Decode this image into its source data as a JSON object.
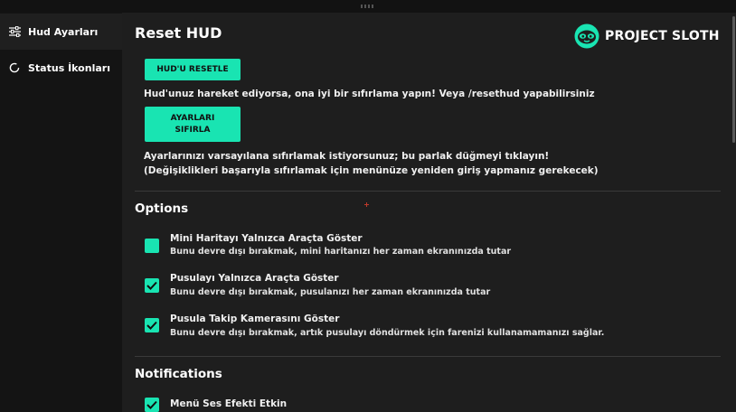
{
  "sidebar": {
    "items": [
      {
        "label": "Hud Ayarları",
        "icon": "sliders-icon",
        "active": true
      },
      {
        "label": "Status İkonları",
        "icon": "circle-loader-icon",
        "active": false
      }
    ]
  },
  "header": {
    "title": "Reset HUD",
    "logo_text": "PROJECT SLOTH"
  },
  "reset": {
    "hud_button": "HUD'U RESETLE",
    "hud_text": "Hud'unuz hareket ediyorsa, ona iyi bir sıfırlama yapın! Veya /resethud yapabilirsiniz",
    "settings_button_line1": "AYARLARI",
    "settings_button_line2": "SIFIRLA",
    "settings_text1": "Ayarlarınızı varsayılana sıfırlamak istiyorsunuz; bu parlak düğmeyi tıklayın!",
    "settings_text2": "(Değişiklikleri başarıyla sıfırlamak için menünüze yeniden giriş yapmanız gerekecek)"
  },
  "options": {
    "title": "Options",
    "items": [
      {
        "title": "Mini Haritayı Yalnızca Araçta Göster",
        "desc": "Bunu devre dışı bırakmak, mini haritanızı her zaman ekranınızda tutar",
        "checked": false
      },
      {
        "title": "Pusulayı Yalnızca Araçta Göster",
        "desc": "Bunu devre dışı bırakmak, pusulanızı her zaman ekranınızda tutar",
        "checked": true
      },
      {
        "title": "Pusula Takip Kamerasını Göster",
        "desc": "Bunu devre dışı bırakmak, artık pusulayı döndürmek için farenizi kullanamamanızı sağlar.",
        "checked": true
      }
    ]
  },
  "notifications": {
    "title": "Notifications",
    "items": [
      {
        "title": "Menü Ses Efekti Etkin",
        "checked": true
      }
    ]
  },
  "colors": {
    "accent": "#19e4b2",
    "background": "#1e1e1e",
    "sidebar": "#141414"
  }
}
